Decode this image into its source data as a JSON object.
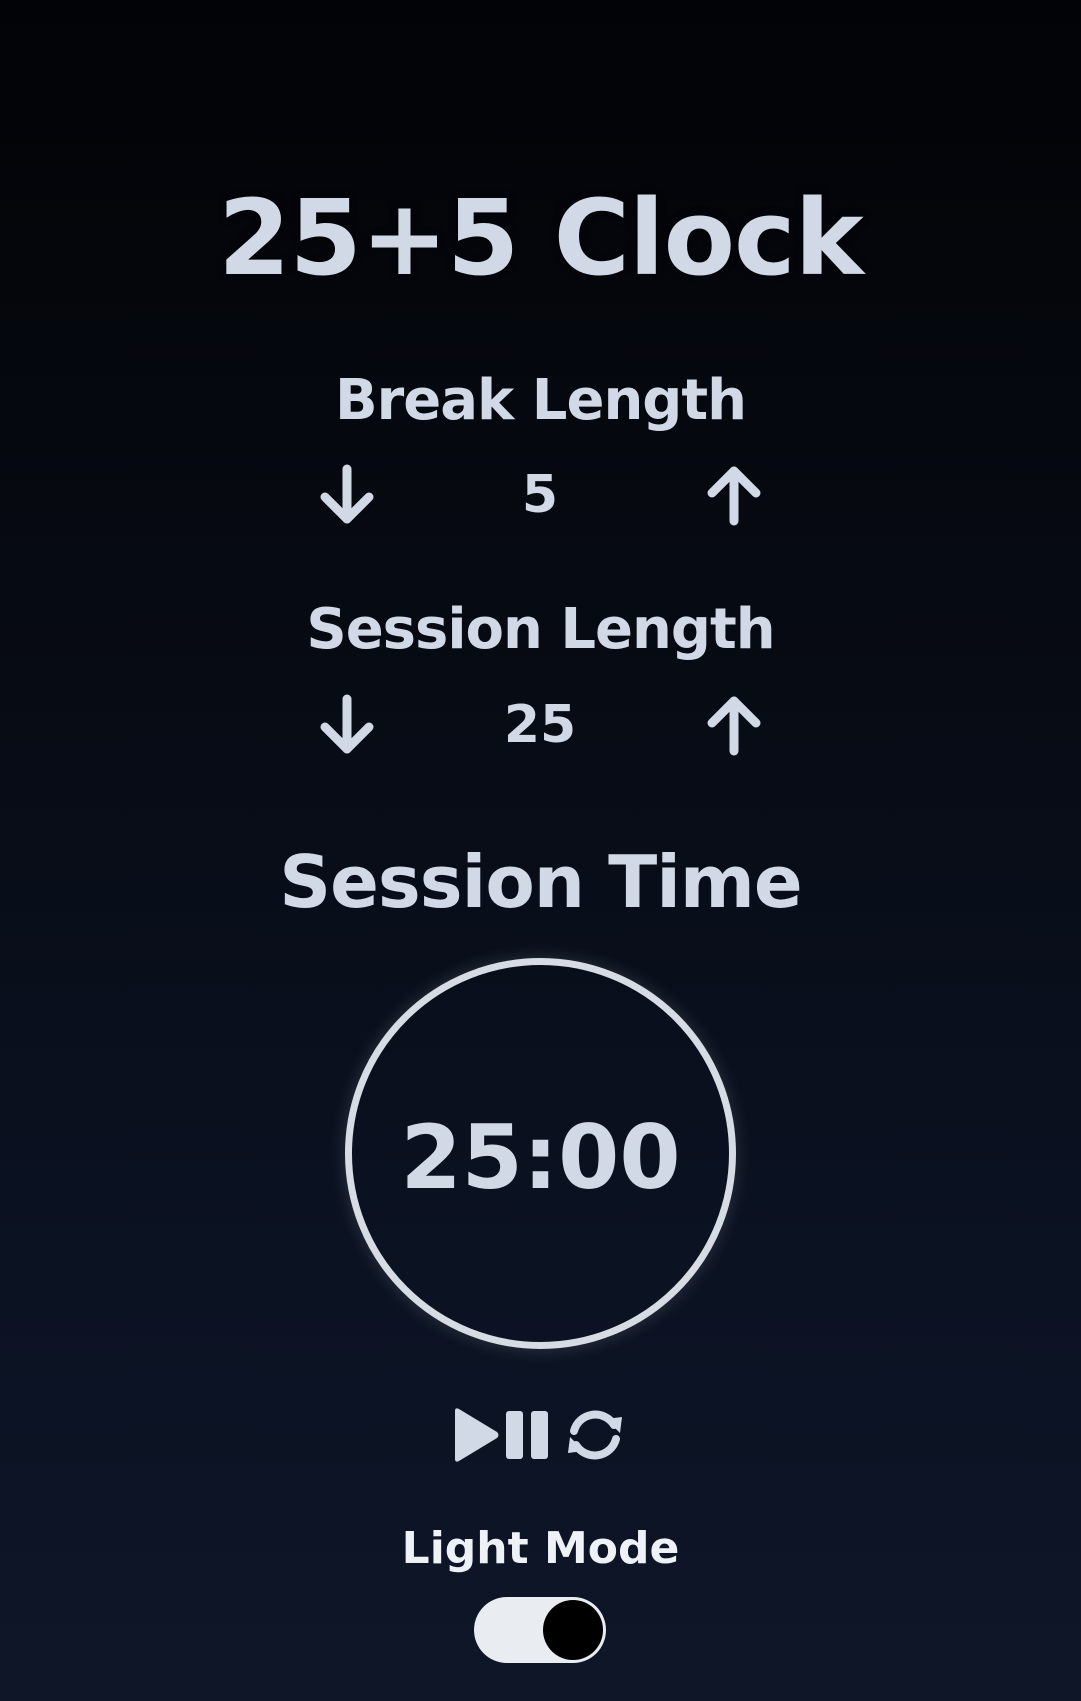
{
  "app": {
    "title": "25+5 Clock"
  },
  "break": {
    "label": "Break Length",
    "value": "5",
    "decrement_icon": "arrow-down-icon",
    "increment_icon": "arrow-up-icon"
  },
  "session": {
    "label": "Session Length",
    "value": "25",
    "decrement_icon": "arrow-down-icon",
    "increment_icon": "arrow-up-icon"
  },
  "timer": {
    "label": "Session Time",
    "display": "25:00"
  },
  "controls": {
    "icons": [
      "play-icon",
      "pause-icon",
      "refresh-icon"
    ]
  },
  "theme": {
    "toggle_label": "Light Mode",
    "toggle_on": true,
    "colors": {
      "text": "#d2d9e6",
      "background_top": "#020306",
      "background_bottom": "#0e1628",
      "toggle_track": "#e9ecf1",
      "toggle_knob": "#000000"
    }
  }
}
